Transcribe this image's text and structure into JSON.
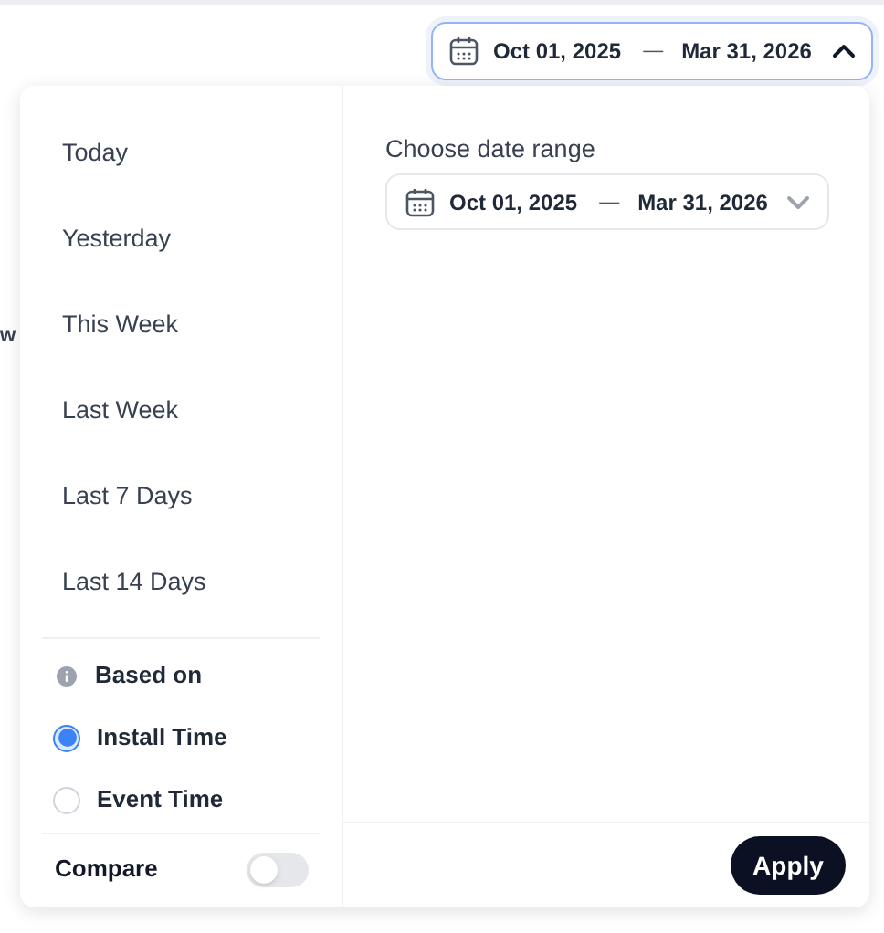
{
  "background": {
    "fragment": "w"
  },
  "header_range": {
    "start": "Oct 01, 2025",
    "separator": "—",
    "end": "Mar 31, 2026",
    "expanded": true
  },
  "presets": [
    {
      "label": "Today",
      "selected": false
    },
    {
      "label": "Yesterday",
      "selected": false
    },
    {
      "label": "This Week",
      "selected": false
    },
    {
      "label": "Last Week",
      "selected": false
    },
    {
      "label": "Last 7 Days",
      "selected": false
    },
    {
      "label": "Last 14 Days",
      "selected": false
    }
  ],
  "based_on": {
    "title": "Based on",
    "options": [
      {
        "label": "Install Time",
        "selected": true
      },
      {
        "label": "Event Time",
        "selected": false
      }
    ]
  },
  "compare": {
    "label": "Compare",
    "on": false
  },
  "custom_range": {
    "title": "Choose date range",
    "start": "Oct 01, 2025",
    "separator": "—",
    "end": "Mar 31, 2026",
    "expanded": false
  },
  "apply_button": "Apply"
}
